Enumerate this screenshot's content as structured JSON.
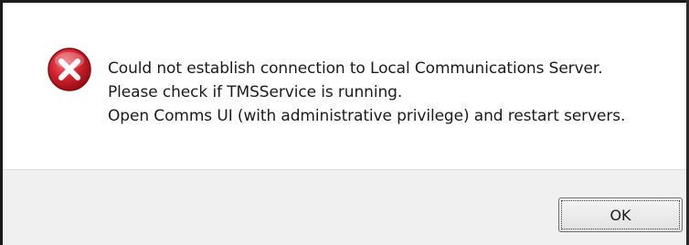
{
  "dialog": {
    "icon": "error-icon",
    "messages": [
      "Could not establish connection to Local Communications Server.",
      "Please check if TMSService is running.",
      "Open Comms UI (with administrative privilege) and restart servers."
    ],
    "ok_label": "OK"
  },
  "colors": {
    "icon_red": "#c8171d",
    "footer_bg": "#f0f0f0",
    "content_bg": "#ffffff"
  }
}
